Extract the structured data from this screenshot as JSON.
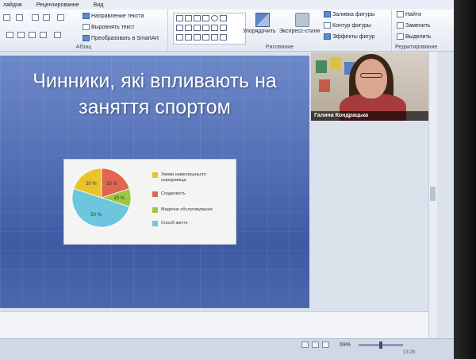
{
  "menu": {
    "items": [
      "лайдов",
      "Рецензирование",
      "Вид"
    ]
  },
  "ribbon": {
    "paragraph": {
      "label": "Абзац",
      "text_direction": "Направление текста",
      "align_text": "Выровнять текст",
      "convert_smartart": "Преобразовать в SmartArt"
    },
    "drawing": {
      "label": "Рисование",
      "arrange": "Упорядочить",
      "quick_styles": "Экспресс-стили",
      "shape_fill": "Заливка фигуры",
      "shape_outline": "Контур фигуры",
      "shape_effects": "Эффекты фигур"
    },
    "editing": {
      "label": "Редактирование",
      "find": "Найти",
      "replace": "Заменить",
      "select": "Выделить"
    }
  },
  "slide": {
    "title": "Чинники, які впливають на заняття спортом"
  },
  "chart_data": {
    "type": "pie",
    "categories": [
      "Умови навколишнього середовища",
      "Спадковість",
      "Медичне обслуговування",
      "Спосіб життя"
    ],
    "values": [
      20,
      20,
      10,
      50
    ],
    "labels": [
      "20 %",
      "20 %",
      "10 %",
      "50 %"
    ],
    "colors": [
      "#e8c32a",
      "#e06650",
      "#9cc744",
      "#6cc6dd"
    ],
    "legend": "right"
  },
  "video": {
    "participant_name": "Галина Кондрацька"
  },
  "status": {
    "zoom": "69%",
    "clock": "13:28"
  }
}
